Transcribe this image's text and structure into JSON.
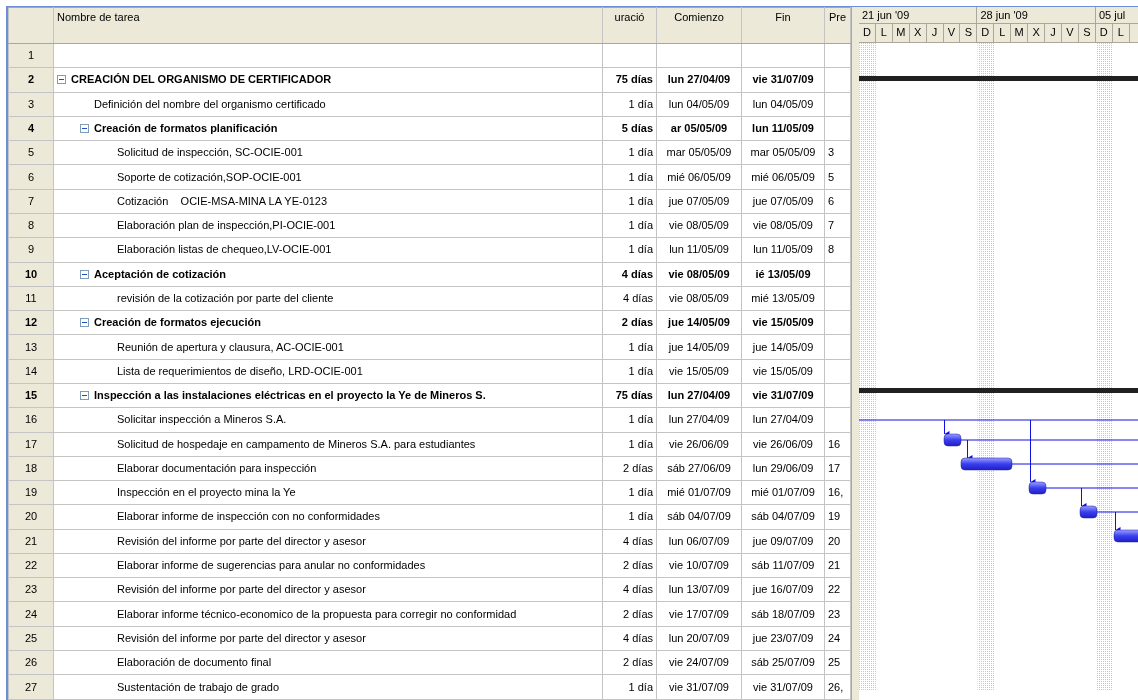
{
  "columns": [
    {
      "kind": "id"
    },
    {
      "kind": "name",
      "label": "Nombre de tarea"
    },
    {
      "kind": "duration",
      "label": "uració"
    },
    {
      "kind": "start",
      "label": "Comienzo"
    },
    {
      "kind": "finish",
      "label": "Fin"
    },
    {
      "kind": "pred",
      "label": "Pre"
    }
  ],
  "timeline": [
    {
      "label": "21 jun '09",
      "days": [
        "D",
        "L",
        "M",
        "X",
        "J",
        "V",
        "S"
      ]
    },
    {
      "label": "28 jun '09",
      "days": [
        "D",
        "L",
        "M",
        "X",
        "J",
        "V",
        "S"
      ]
    },
    {
      "label": "05 jul",
      "days": [
        "D",
        "L"
      ]
    }
  ],
  "tasks": [
    {
      "row_number": "1"
    },
    {
      "row_number": "2",
      "name": "CREACIÓN DEL ORGANISMO DE CERTIFICADOR",
      "duration": "75 días",
      "start": "lun 27/04/09",
      "finish": "vie 31/07/09",
      "expanded": true,
      "children": [
        {
          "row_number": "3",
          "name": "Definición del nombre del organismo certificado",
          "duration": "1 día",
          "start": "lun 04/05/09",
          "finish": "lun 04/05/09"
        },
        {
          "row_number": "4",
          "name": "Creación de formatos planificación",
          "duration": "5 días",
          "start": "ar 05/05/09",
          "finish": "lun 11/05/09",
          "expanded": true,
          "children": [
            {
              "row_number": "5",
              "name": "Solicitud de inspección, SC-OCIE-001",
              "duration": "1 día",
              "start": "mar 05/05/09",
              "finish": "mar 05/05/09",
              "pred": "3"
            },
            {
              "row_number": "6",
              "name": "Soporte de cotización,SOP-OCIE-001",
              "duration": "1 día",
              "start": "mié 06/05/09",
              "finish": "mié 06/05/09",
              "pred": "5"
            },
            {
              "row_number": "7",
              "name": "Cotización    OCIE-MSA-MINA LA YE-0123",
              "duration": "1 día",
              "start": "jue 07/05/09",
              "finish": "jue 07/05/09",
              "pred": "6"
            },
            {
              "row_number": "8",
              "name": "Elaboración plan de inspección,PI-OCIE-001",
              "duration": "1 día",
              "start": "vie 08/05/09",
              "finish": "vie 08/05/09",
              "pred": "7"
            },
            {
              "row_number": "9",
              "name": "Elaboración listas de chequeo,LV-OCIE-001",
              "duration": "1 día",
              "start": "lun 11/05/09",
              "finish": "lun 11/05/09",
              "pred": "8"
            }
          ]
        },
        {
          "row_number": "10",
          "name": "Aceptación de cotización",
          "duration": "4 días",
          "start": "vie 08/05/09",
          "finish": "ié 13/05/09",
          "expanded": true,
          "children": [
            {
              "row_number": "11",
              "name": "revisión de la cotización por parte del cliente",
              "duration": "4 días",
              "start": "vie 08/05/09",
              "finish": "mié 13/05/09"
            }
          ]
        },
        {
          "row_number": "12",
          "name": "Creación de formatos ejecución",
          "duration": "2 días",
          "start": "jue 14/05/09",
          "finish": "vie 15/05/09",
          "expanded": true,
          "children": [
            {
              "row_number": "13",
              "name": "Reunión de apertura y clausura, AC-OCIE-001",
              "duration": "1 día",
              "start": "jue 14/05/09",
              "finish": "jue 14/05/09"
            },
            {
              "row_number": "14",
              "name": "Lista de requerimientos de diseño, LRD-OCIE-001",
              "duration": "1 día",
              "start": "vie 15/05/09",
              "finish": "vie 15/05/09"
            }
          ]
        },
        {
          "row_number": "15",
          "name": "Inspección a las instalaciones eléctricas en el proyecto la Ye de Mineros S.",
          "duration": "75 días",
          "start": "lun 27/04/09",
          "finish": "vie 31/07/09",
          "expanded": true,
          "children": [
            {
              "row_number": "16",
              "name": "Solicitar inspección a Mineros S.A.",
              "duration": "1 día",
              "start": "lun 27/04/09",
              "finish": "lun 27/04/09"
            },
            {
              "row_number": "17",
              "name": "Solicitud de hospedaje en campamento de Mineros S.A. para estudiantes",
              "duration": "1 día",
              "start": "vie 26/06/09",
              "finish": "vie 26/06/09",
              "pred": "16"
            },
            {
              "row_number": "18",
              "name": "Elaborar documentación para inspección",
              "duration": "2 días",
              "start": "sáb 27/06/09",
              "finish": "lun 29/06/09",
              "pred": "17"
            },
            {
              "row_number": "19",
              "name": "Inspección en el proyecto mina la Ye",
              "duration": "1 día",
              "start": "mié 01/07/09",
              "finish": "mié 01/07/09",
              "pred": "16,"
            },
            {
              "row_number": "20",
              "name": "Elaborar informe de inspección con no conformidades",
              "duration": "1 día",
              "start": "sáb 04/07/09",
              "finish": "sáb 04/07/09",
              "pred": "19"
            },
            {
              "row_number": "21",
              "name": "Revisión del informe por parte del director y asesor",
              "duration": "4 días",
              "start": "lun 06/07/09",
              "finish": "jue 09/07/09",
              "pred": "20"
            },
            {
              "row_number": "22",
              "name": "Elaborar informe de sugerencias para anular no conformidades",
              "duration": "2 días",
              "start": "vie 10/07/09",
              "finish": "sáb 11/07/09",
              "pred": "21"
            },
            {
              "row_number": "23",
              "name": "Revisión del informe por parte del director y asesor",
              "duration": "4 días",
              "start": "lun 13/07/09",
              "finish": "jue 16/07/09",
              "pred": "22"
            },
            {
              "row_number": "24",
              "name": "Elaborar informe técnico-economico de la propuesta para corregir no conformidad",
              "duration": "2 días",
              "start": "vie 17/07/09",
              "finish": "sáb 18/07/09",
              "pred": "23"
            },
            {
              "row_number": "25",
              "name": "Revisión del informe por parte del director y asesor",
              "duration": "4 días",
              "start": "lun 20/07/09",
              "finish": "jue 23/07/09",
              "pred": "24"
            },
            {
              "row_number": "26",
              "name": "Elaboración de documento final",
              "duration": "2 días",
              "start": "vie 24/07/09",
              "finish": "sáb 25/07/09",
              "pred": "25"
            },
            {
              "row_number": "27",
              "name": "Sustentación de trabajo de grado",
              "duration": "1 día",
              "start": "vie 31/07/09",
              "finish": "vie 31/07/09",
              "pred": "26,"
            }
          ]
        }
      ]
    }
  ]
}
